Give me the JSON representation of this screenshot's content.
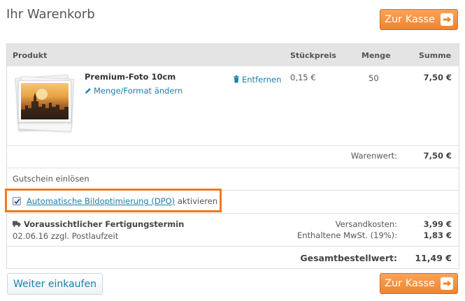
{
  "page": {
    "title": "Ihr Warenkorb"
  },
  "checkout_label": "Zur Kasse",
  "table": {
    "headers": {
      "product": "Produkt",
      "unit_price": "Stückpreis",
      "quantity": "Menge",
      "sum": "Summe"
    },
    "items": [
      {
        "name": "Premium-Foto 10cm",
        "edit_label": "Menge/Format ändern",
        "remove_label": "Entfernen",
        "unit_price": "0,15 €",
        "quantity": "50",
        "sum": "7,50 €"
      }
    ],
    "goods_value_label": "Warenwert:",
    "goods_value": "7,50 €"
  },
  "voucher_label": "Gutschein einlösen",
  "dpo": {
    "checked": true,
    "link_text": "Automatische Bildoptimierung (DPO)",
    "suffix_text": "aktivieren"
  },
  "production": {
    "title": "Voraussichtlicher Fertigungstermin",
    "date_text": "02.06.16 zzgl. Postlaufzeit"
  },
  "totals": {
    "shipping_label": "Versandkosten:",
    "shipping_value": "3,99 €",
    "vat_label": "Enthaltene MwSt. (19%):",
    "vat_value": "1,83 €",
    "grand_total_label": "Gesamtbestellwert:",
    "grand_total_value": "11,49 €"
  },
  "continue_shopping_label": "Weiter einkaufen",
  "colors": {
    "accent_orange": "#f0842a",
    "link_blue": "#1a7fa8",
    "header_gray": "#e4e4e4",
    "highlight_border": "#f07a1f"
  }
}
